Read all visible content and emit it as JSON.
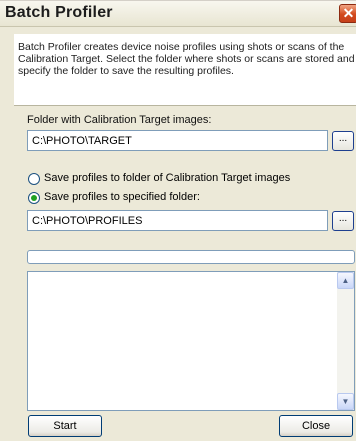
{
  "window": {
    "title": "Batch Profiler",
    "close_glyph": "✕"
  },
  "description": "Batch Profiler creates device noise profiles using shots or scans of the Calibration Target. Select the folder where shots or scans are stored and specify the folder to save the resulting profiles.",
  "source_folder": {
    "label": "Folder with Calibration Target images:",
    "value": "C:\\PHOTO\\TARGET",
    "browse_label": "..."
  },
  "save_options": [
    {
      "label": "Save profiles to folder of Calibration Target images",
      "checked": false
    },
    {
      "label": "Save profiles to specified folder:",
      "checked": true
    }
  ],
  "dest_folder": {
    "value": "C:\\PHOTO\\PROFILES",
    "browse_label": "..."
  },
  "progress": {
    "fraction": 0
  },
  "log": {
    "text": "",
    "scroll_up_icon": "chevron-up-icon",
    "scroll_down_icon": "chevron-down-icon"
  },
  "buttons": {
    "start": "Start",
    "close": "Close"
  }
}
